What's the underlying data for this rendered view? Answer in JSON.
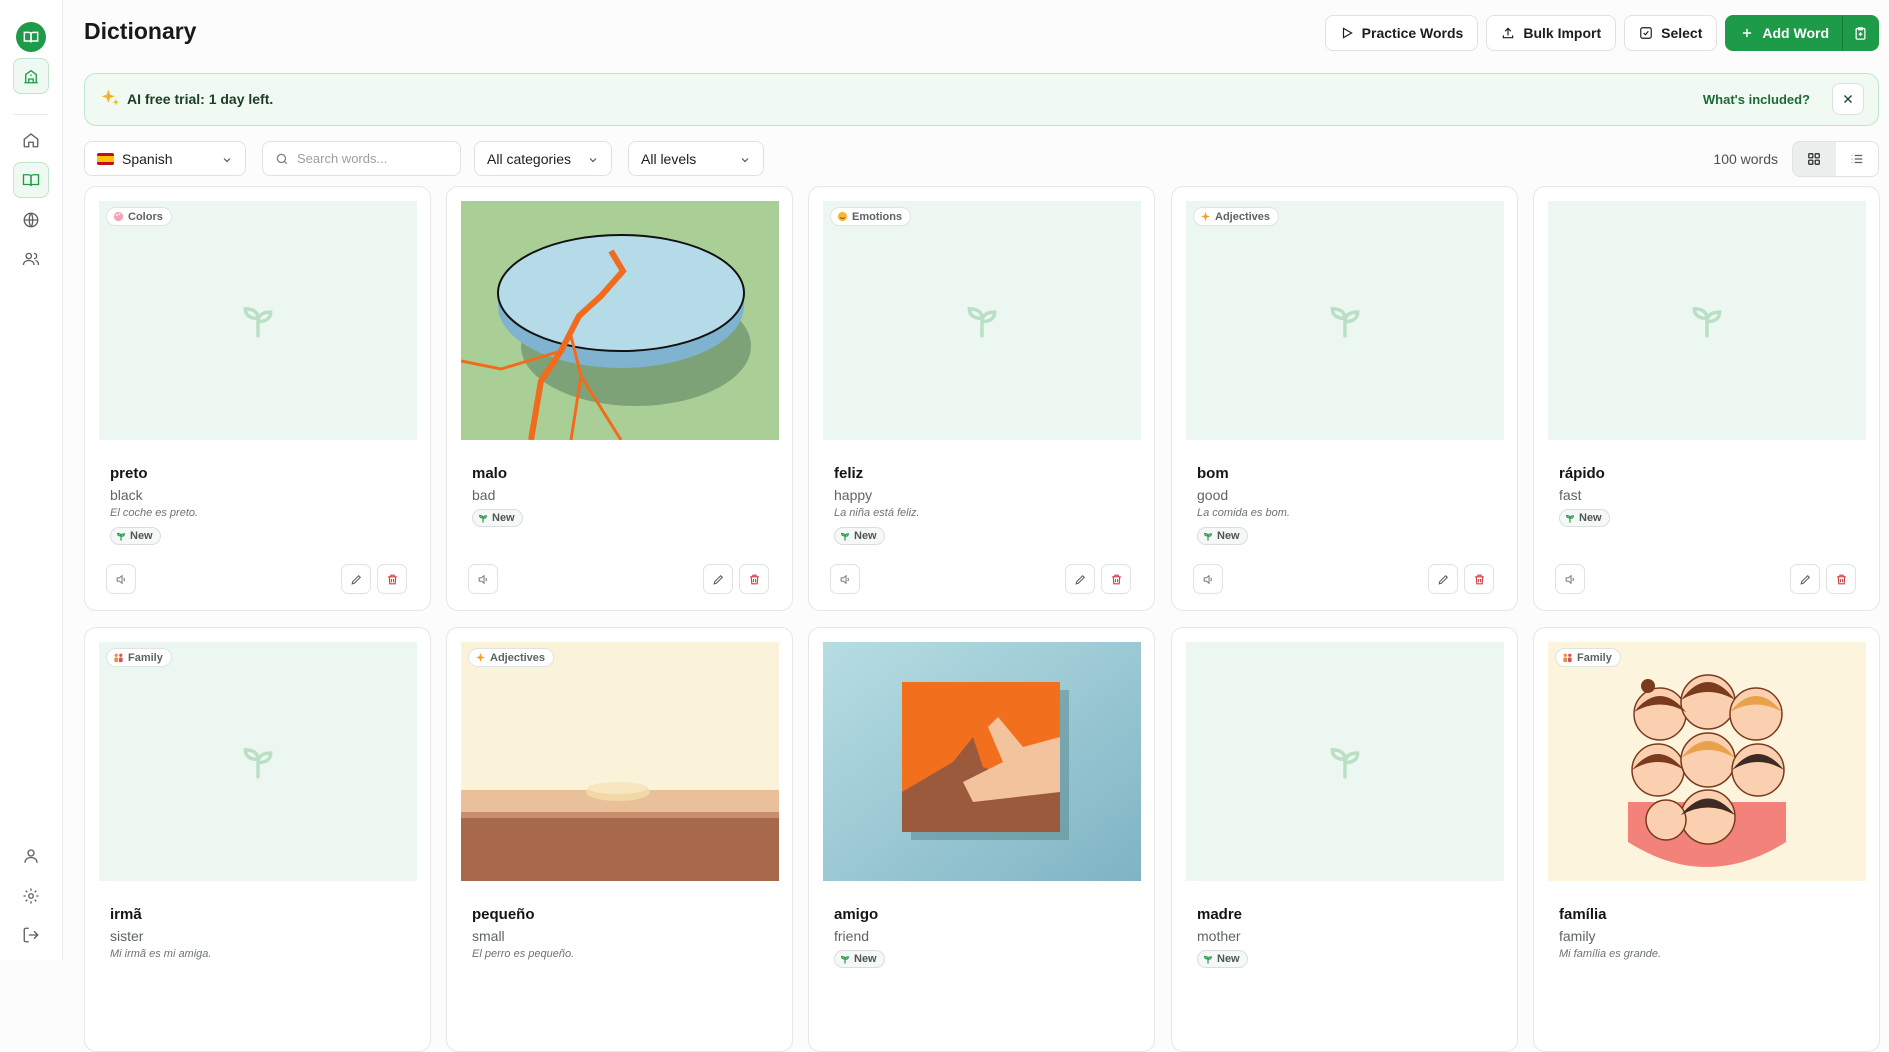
{
  "header": {
    "title": "Dictionary"
  },
  "toolbar": {
    "practice_label": "Practice Words",
    "import_label": "Bulk Import",
    "select_label": "Select",
    "add_label": "Add Word"
  },
  "banner": {
    "text": "AI free trial: 1 day left.",
    "link": "What's included?"
  },
  "filters": {
    "language": "Spanish",
    "search_placeholder": "Search words...",
    "category": "All categories",
    "level": "All levels",
    "count": "100 words"
  },
  "colors": {
    "brand": "#1e9b48",
    "danger": "#d63b3b"
  },
  "cards": [
    {
      "word": "preto",
      "translation": "black",
      "example": "El coche es preto.",
      "category": "Colors",
      "category_icon": "palette-icon",
      "status": "New",
      "image": "placeholder"
    },
    {
      "word": "malo",
      "translation": "bad",
      "example": "",
      "category": "",
      "status": "New",
      "image": "cracked-stone"
    },
    {
      "word": "feliz",
      "translation": "happy",
      "example": "La niña está feliz.",
      "category": "Emotions",
      "category_icon": "smile-icon",
      "status": "New",
      "image": "placeholder"
    },
    {
      "word": "bom",
      "translation": "good",
      "example": "La comida es bom.",
      "category": "Adjectives",
      "category_icon": "sparkle-icon",
      "status": "New",
      "image": "placeholder"
    },
    {
      "word": "rápido",
      "translation": "fast",
      "example": "",
      "category": "",
      "status": "New",
      "image": "placeholder"
    },
    {
      "word": "irmã",
      "translation": "sister",
      "example": "Mi irmã es mi amiga.",
      "category": "Family",
      "category_icon": "family-icon",
      "status": "",
      "image": "placeholder"
    },
    {
      "word": "pequeño",
      "translation": "small",
      "example": "El perro es pequeño.",
      "category": "Adjectives",
      "category_icon": "sparkle-icon",
      "status": "",
      "image": "small-seed"
    },
    {
      "word": "amigo",
      "translation": "friend",
      "example": "",
      "category": "",
      "status": "New",
      "image": "hands"
    },
    {
      "word": "madre",
      "translation": "mother",
      "example": "",
      "category": "",
      "status": "New",
      "image": "placeholder"
    },
    {
      "word": "família",
      "translation": "family",
      "example": "Mi família es grande.",
      "category": "Family",
      "category_icon": "family-icon",
      "status": "",
      "image": "family-faces"
    }
  ]
}
